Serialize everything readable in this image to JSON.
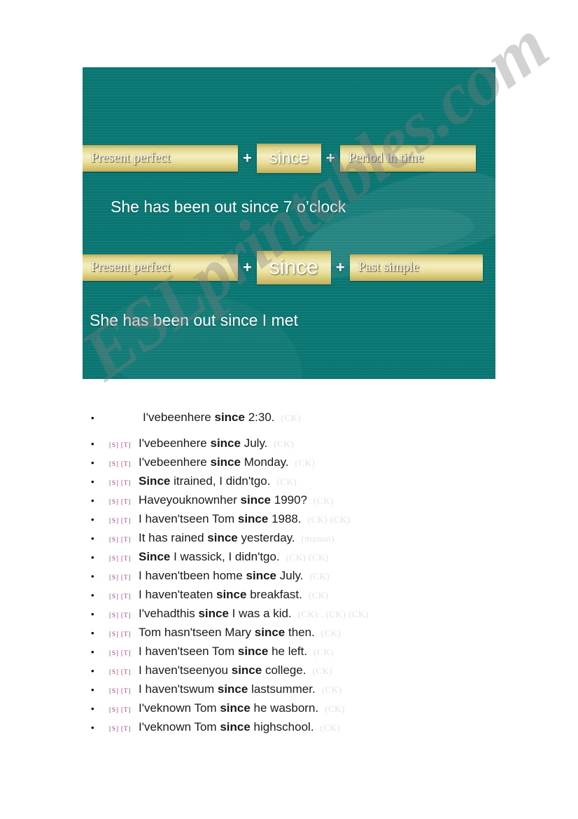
{
  "slide": {
    "background_color": "#0b7a76",
    "accent_color": "#f0e6a8",
    "rows": [
      {
        "left_label": "Present perfect",
        "operator1": "+",
        "middle_label": "since",
        "operator2": "+",
        "right_label": "Period in time",
        "example": "She has been out since 7 o’clock"
      },
      {
        "left_label": "Present perfect",
        "operator1": "+",
        "middle_label": "since",
        "operator2": "+",
        "right_label": "Past simple",
        "example": "She has been out since I met"
      }
    ]
  },
  "watermark": "ESLprintables.com",
  "list": {
    "tag_s": "[S]",
    "tag_t": "[T]",
    "bullet_glyph": "•",
    "items": [
      {
        "has_tags": false,
        "pre": "I'vebeenhere ",
        "keyword": "since",
        "post": " 2:30.",
        "credits": "(CK)"
      },
      {
        "has_tags": true,
        "pre": "I'vebeenhere ",
        "keyword": "since",
        "post": " July.",
        "credits": "(CK)"
      },
      {
        "has_tags": true,
        "pre": "I'vebeenhere ",
        "keyword": "since",
        "post": " Monday.",
        "credits": "(CK)"
      },
      {
        "has_tags": true,
        "pre": "",
        "keyword": "Since",
        "post": " itrained, I didn'tgo.",
        "credits": "(CK)"
      },
      {
        "has_tags": true,
        "pre": "Haveyouknownher ",
        "keyword": "since",
        "post": " 1990?",
        "credits": "(CK)"
      },
      {
        "has_tags": true,
        "pre": "I haven'tseen Tom ",
        "keyword": "since",
        "post": " 1988.",
        "credits": "(CK) (CK)"
      },
      {
        "has_tags": true,
        "pre": "It has rained ",
        "keyword": "since",
        "post": " yesterday.",
        "credits": "(mamat)"
      },
      {
        "has_tags": true,
        "pre": "",
        "keyword": "Since",
        "post": " I wassick, I didn'tgo.",
        "credits": "(CK) (CK)"
      },
      {
        "has_tags": true,
        "pre": "I haven'tbeen home ",
        "keyword": "since",
        "post": " July.",
        "credits": "(CK)"
      },
      {
        "has_tags": true,
        "pre": "I haven'teaten ",
        "keyword": "since",
        "post": " breakfast.",
        "credits": "(CK)"
      },
      {
        "has_tags": true,
        "pre": "I'vehadthis ",
        "keyword": "since",
        "post": " I was a kid.",
        "credits": "(CK) . (CK) (CK)"
      },
      {
        "has_tags": true,
        "pre": "Tom hasn'tseen Mary ",
        "keyword": "since",
        "post": " then.",
        "credits": "(CK)"
      },
      {
        "has_tags": true,
        "pre": "I haven'tseen Tom ",
        "keyword": "since",
        "post": " he left.",
        "credits": "(CK)"
      },
      {
        "has_tags": true,
        "pre": "I haven'tseenyou ",
        "keyword": "since",
        "post": " college.",
        "credits": "(CK)"
      },
      {
        "has_tags": true,
        "pre": "I haven'tswum ",
        "keyword": "since",
        "post": " lastsummer.",
        "credits": "(CK)"
      },
      {
        "has_tags": true,
        "pre": "I'veknown Tom ",
        "keyword": "since",
        "post": " he wasborn.",
        "credits": "(CK)"
      },
      {
        "has_tags": true,
        "pre": "I'veknown Tom ",
        "keyword": "since",
        "post": " highschool.",
        "credits": "(CK)"
      }
    ]
  }
}
